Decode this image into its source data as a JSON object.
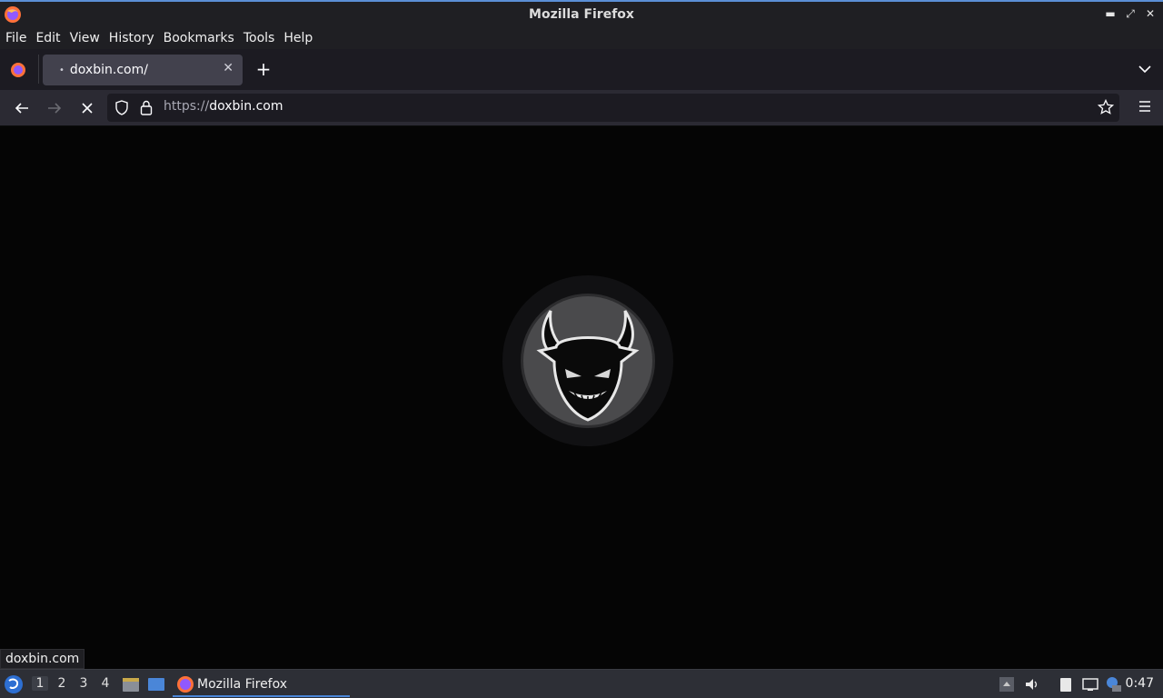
{
  "window": {
    "title": "Mozilla Firefox"
  },
  "menubar": {
    "items": [
      "File",
      "Edit",
      "View",
      "History",
      "Bookmarks",
      "Tools",
      "Help"
    ]
  },
  "tabs": [
    {
      "label": "doxbin.com/",
      "loading": true
    }
  ],
  "navbar": {
    "url_scheme": "https://",
    "url_host": "doxbin.com"
  },
  "status": {
    "hover_link": "doxbin.com"
  },
  "taskbar": {
    "workspaces": [
      "1",
      "2",
      "3",
      "4"
    ],
    "active_workspace": "1",
    "task_label": "Mozilla Firefox",
    "clock": "0:47"
  },
  "colors": {
    "accent": "#4a86d8",
    "page_bg": "#050505",
    "chrome_bg": "#2b2a33"
  }
}
